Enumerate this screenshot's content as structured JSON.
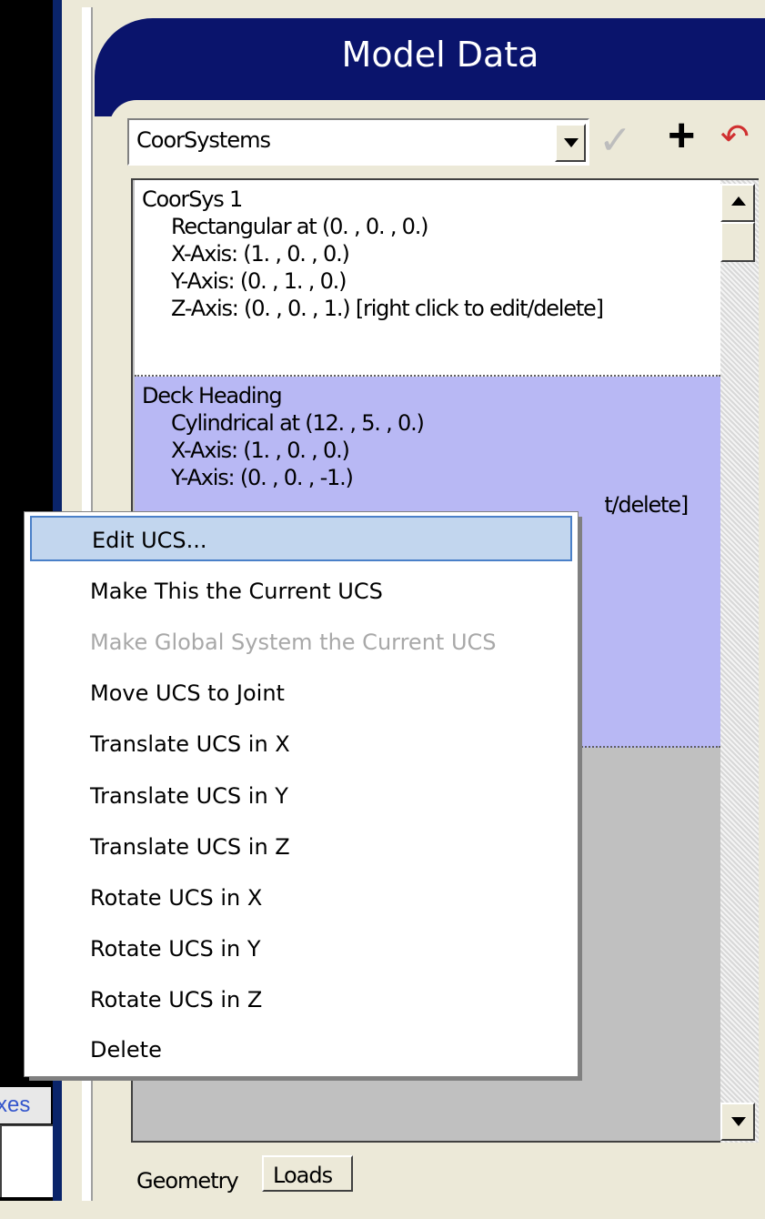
{
  "left_panel": {
    "label_text": "xes"
  },
  "panel": {
    "title": "Model Data"
  },
  "combo": {
    "value": "CoorSystems"
  },
  "list": {
    "items": [
      {
        "name": "CoorSys 1",
        "lines": [
          "Rectangular at (0. , 0. , 0.)",
          "X-Axis: (1. , 0. , 0.)",
          "Y-Axis: (0. , 1. , 0.)",
          "Z-Axis: (0. , 0. , 1.)  [right click to edit/delete]"
        ]
      },
      {
        "name": "Deck Heading",
        "lines": [
          "Cylindrical at (12. , 5. , 0.)",
          "X-Axis: (1. , 0. , 0.)",
          "Y-Axis: (0. , 0. , -1.)",
          "t/delete]"
        ]
      }
    ]
  },
  "tabs": [
    "Geometry",
    "Loads"
  ],
  "context_menu": {
    "items": [
      {
        "label": "Edit UCS...",
        "state": "selected"
      },
      {
        "label": "Make This the Current UCS",
        "state": "normal"
      },
      {
        "label": "Make Global System the Current UCS",
        "state": "disabled"
      },
      {
        "label": "Move UCS to Joint",
        "state": "normal"
      },
      {
        "label": "Translate UCS in X",
        "state": "normal"
      },
      {
        "label": "Translate UCS in Y",
        "state": "normal"
      },
      {
        "label": "Translate UCS in Z",
        "state": "normal"
      },
      {
        "label": "Rotate UCS in X",
        "state": "normal"
      },
      {
        "label": "Rotate UCS in Y",
        "state": "normal"
      },
      {
        "label": "Rotate UCS in Z",
        "state": "normal"
      },
      {
        "label": "Delete",
        "state": "normal"
      }
    ]
  },
  "icons": {
    "check": "checkmark-icon",
    "plus": "plus-icon",
    "undo": "undo-icon"
  },
  "colors": {
    "title_bar": "#0a146c",
    "selected_item": "#b8b8f4",
    "menu_highlight": "#c2d6ee"
  }
}
